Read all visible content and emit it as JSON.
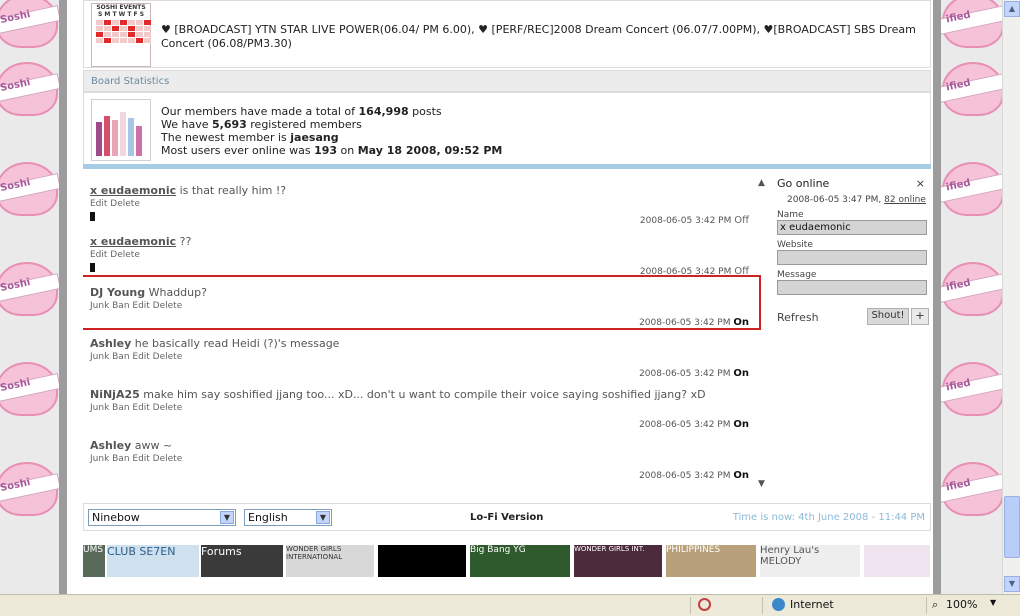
{
  "background": {
    "badge_label": "Soshified",
    "badge_label_short": "Soshi",
    "badge_label_right": "ified"
  },
  "events": {
    "image_caption": "SOSHI EVENTS",
    "image_days": "S M T W T F S",
    "text": "♥ [BROADCAST] YTN STAR LIVE POWER(06.04/ PM 6.00), ♥ [PERF/REC]2008 Dream Concert (06.07/7.00PM), ♥[BROADCAST] SBS Dream Concert (06.08/PM3.30)"
  },
  "stats": {
    "header": "Board Statistics",
    "line1_pre": "Our members have made a total of ",
    "posts": "164,998",
    "line1_post": " posts",
    "line2_pre": "We have ",
    "members": "5,693",
    "line2_post": " registered members",
    "line3_pre": "The newest member is ",
    "newest": "jaesang",
    "line4_pre": "Most users ever online was ",
    "max_online": "193",
    "line4_mid": " on ",
    "max_date": "May 18 2008, 09:52 PM"
  },
  "shouts": [
    {
      "user": "x eudaemonic",
      "message": " is that really him !?",
      "actions": "Edit Delete",
      "time": "2008-06-05 3:42 PM",
      "status": "Off"
    },
    {
      "user": "x eudaemonic",
      "message": " ??",
      "actions": "Edit Delete",
      "time": "2008-06-05 3:42 PM",
      "status": "Off"
    },
    {
      "user": "DJ Young",
      "message": " Whaddup?",
      "actions": "Junk Ban Edit Delete",
      "time": "2008-06-05 3:42 PM",
      "status": "On"
    },
    {
      "user": "Ashley",
      "message": " he basically read Heidi (?)'s message",
      "actions": "Junk Ban Edit Delete",
      "time": "2008-06-05 3:42 PM",
      "status": "On"
    },
    {
      "user": "NiNjA25",
      "message": " make him say soshified jjang too... xD... don't u want to compile their voice saying soshified jjang? xD",
      "actions": "Junk Ban Edit Delete",
      "time": "2008-06-05 3:42 PM",
      "status": "On"
    },
    {
      "user": "Ashley",
      "message": " aww ~",
      "actions": "Junk Ban Edit Delete",
      "time": "2008-06-05 3:42 PM",
      "status": "On"
    }
  ],
  "side": {
    "title": "Go online",
    "close": "×",
    "info_time": "2008-06-05 3:47 PM, ",
    "info_online": "82 online",
    "name_label": "Name",
    "name_value": "x eudaemonic",
    "website_label": "Website",
    "website_value": "",
    "message_label": "Message",
    "message_value": "",
    "refresh": "Refresh",
    "shout_button": "Shout!",
    "plus_button": "+"
  },
  "footer": {
    "skin": "Ninebow",
    "language": "English",
    "lofi": "Lo-Fi Version",
    "time": "Time is now: 4th June 2008 - 11:44 PM"
  },
  "banners": [
    "UMS",
    "CLUB SE7EN",
    "Forums",
    "WONDER GIRLS INTERNATIONAL",
    "",
    "Big Bang YG",
    "WONDER GIRLS INT.",
    "PHILIPPINES",
    "Henry Lau's MELODY",
    ""
  ],
  "statusbar": {
    "zone": "Internet",
    "zoom": "100%"
  },
  "colors": {
    "highlight": "#cc2222",
    "time_text": "#8cbbd6",
    "separator": "#a7cde6"
  }
}
